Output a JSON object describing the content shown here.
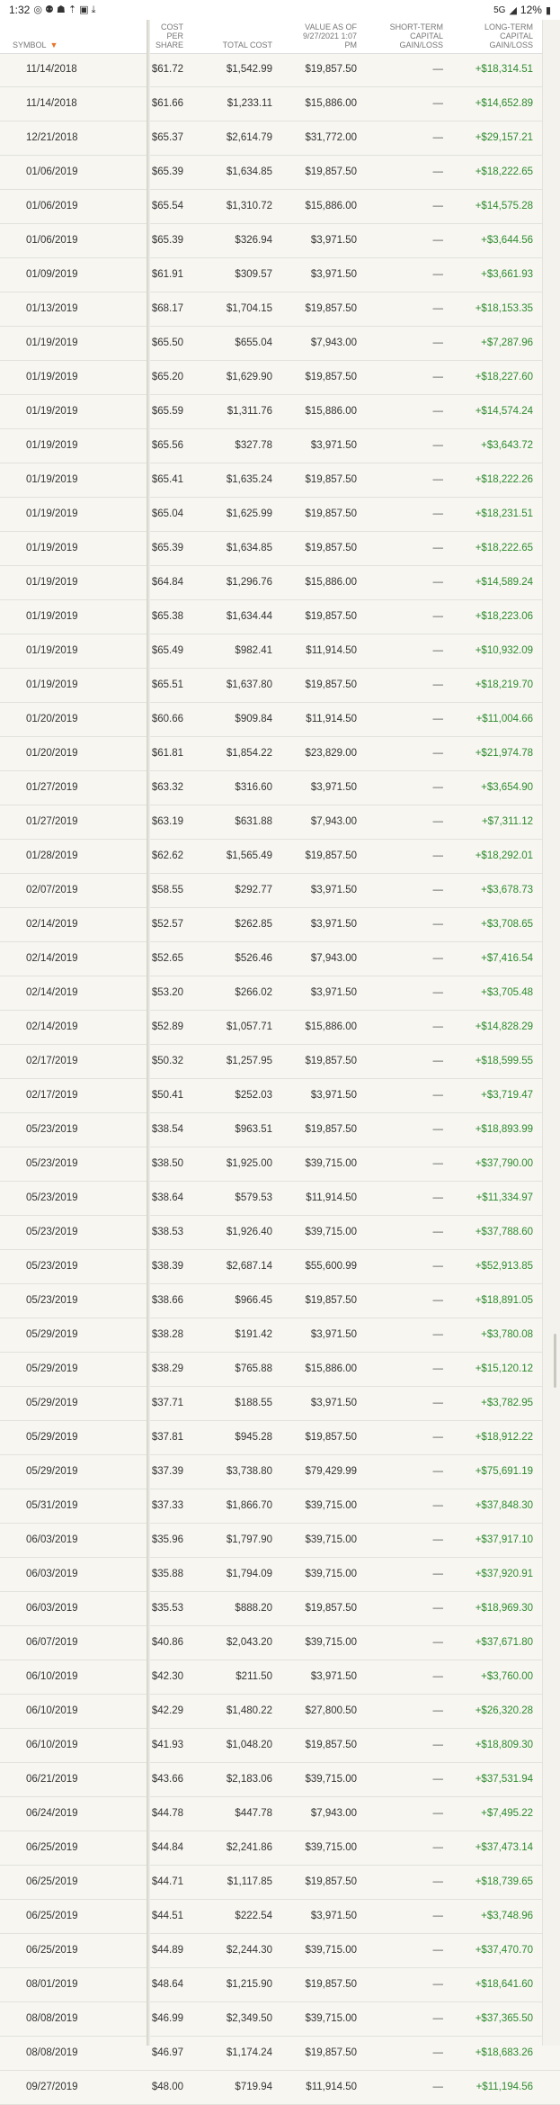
{
  "statusbar": {
    "time": "1:32",
    "network": "5G",
    "battery": "12%"
  },
  "header": {
    "symbol": "SYMBOL",
    "cost_per_share": [
      "COST",
      "PER",
      "SHARE"
    ],
    "total_cost": "TOTAL COST",
    "value_as_of": [
      "VALUE AS OF",
      "9/27/2021 1:07",
      "PM"
    ],
    "short_term": [
      "SHORT-TERM",
      "CAPITAL",
      "GAIN/LOSS"
    ],
    "long_term": [
      "LONG-TERM",
      "CAPITAL",
      "GAIN/LOSS"
    ]
  },
  "rows": [
    {
      "date": "11/14/2018",
      "cps": "$61.72",
      "tc": "$1,542.99",
      "val": "$19,857.50",
      "st": "—",
      "lt": "+$18,314.51"
    },
    {
      "date": "11/14/2018",
      "cps": "$61.66",
      "tc": "$1,233.11",
      "val": "$15,886.00",
      "st": "—",
      "lt": "+$14,652.89"
    },
    {
      "date": "12/21/2018",
      "cps": "$65.37",
      "tc": "$2,614.79",
      "val": "$31,772.00",
      "st": "—",
      "lt": "+$29,157.21"
    },
    {
      "date": "01/06/2019",
      "cps": "$65.39",
      "tc": "$1,634.85",
      "val": "$19,857.50",
      "st": "—",
      "lt": "+$18,222.65"
    },
    {
      "date": "01/06/2019",
      "cps": "$65.54",
      "tc": "$1,310.72",
      "val": "$15,886.00",
      "st": "—",
      "lt": "+$14,575.28"
    },
    {
      "date": "01/06/2019",
      "cps": "$65.39",
      "tc": "$326.94",
      "val": "$3,971.50",
      "st": "—",
      "lt": "+$3,644.56"
    },
    {
      "date": "01/09/2019",
      "cps": "$61.91",
      "tc": "$309.57",
      "val": "$3,971.50",
      "st": "—",
      "lt": "+$3,661.93"
    },
    {
      "date": "01/13/2019",
      "cps": "$68.17",
      "tc": "$1,704.15",
      "val": "$19,857.50",
      "st": "—",
      "lt": "+$18,153.35"
    },
    {
      "date": "01/19/2019",
      "cps": "$65.50",
      "tc": "$655.04",
      "val": "$7,943.00",
      "st": "—",
      "lt": "+$7,287.96"
    },
    {
      "date": "01/19/2019",
      "cps": "$65.20",
      "tc": "$1,629.90",
      "val": "$19,857.50",
      "st": "—",
      "lt": "+$18,227.60"
    },
    {
      "date": "01/19/2019",
      "cps": "$65.59",
      "tc": "$1,311.76",
      "val": "$15,886.00",
      "st": "—",
      "lt": "+$14,574.24"
    },
    {
      "date": "01/19/2019",
      "cps": "$65.56",
      "tc": "$327.78",
      "val": "$3,971.50",
      "st": "—",
      "lt": "+$3,643.72"
    },
    {
      "date": "01/19/2019",
      "cps": "$65.41",
      "tc": "$1,635.24",
      "val": "$19,857.50",
      "st": "—",
      "lt": "+$18,222.26"
    },
    {
      "date": "01/19/2019",
      "cps": "$65.04",
      "tc": "$1,625.99",
      "val": "$19,857.50",
      "st": "—",
      "lt": "+$18,231.51"
    },
    {
      "date": "01/19/2019",
      "cps": "$65.39",
      "tc": "$1,634.85",
      "val": "$19,857.50",
      "st": "—",
      "lt": "+$18,222.65"
    },
    {
      "date": "01/19/2019",
      "cps": "$64.84",
      "tc": "$1,296.76",
      "val": "$15,886.00",
      "st": "—",
      "lt": "+$14,589.24"
    },
    {
      "date": "01/19/2019",
      "cps": "$65.38",
      "tc": "$1,634.44",
      "val": "$19,857.50",
      "st": "—",
      "lt": "+$18,223.06"
    },
    {
      "date": "01/19/2019",
      "cps": "$65.49",
      "tc": "$982.41",
      "val": "$11,914.50",
      "st": "—",
      "lt": "+$10,932.09"
    },
    {
      "date": "01/19/2019",
      "cps": "$65.51",
      "tc": "$1,637.80",
      "val": "$19,857.50",
      "st": "—",
      "lt": "+$18,219.70"
    },
    {
      "date": "01/20/2019",
      "cps": "$60.66",
      "tc": "$909.84",
      "val": "$11,914.50",
      "st": "—",
      "lt": "+$11,004.66"
    },
    {
      "date": "01/20/2019",
      "cps": "$61.81",
      "tc": "$1,854.22",
      "val": "$23,829.00",
      "st": "—",
      "lt": "+$21,974.78"
    },
    {
      "date": "01/27/2019",
      "cps": "$63.32",
      "tc": "$316.60",
      "val": "$3,971.50",
      "st": "—",
      "lt": "+$3,654.90"
    },
    {
      "date": "01/27/2019",
      "cps": "$63.19",
      "tc": "$631.88",
      "val": "$7,943.00",
      "st": "—",
      "lt": "+$7,311.12"
    },
    {
      "date": "01/28/2019",
      "cps": "$62.62",
      "tc": "$1,565.49",
      "val": "$19,857.50",
      "st": "—",
      "lt": "+$18,292.01"
    },
    {
      "date": "02/07/2019",
      "cps": "$58.55",
      "tc": "$292.77",
      "val": "$3,971.50",
      "st": "—",
      "lt": "+$3,678.73"
    },
    {
      "date": "02/14/2019",
      "cps": "$52.57",
      "tc": "$262.85",
      "val": "$3,971.50",
      "st": "—",
      "lt": "+$3,708.65"
    },
    {
      "date": "02/14/2019",
      "cps": "$52.65",
      "tc": "$526.46",
      "val": "$7,943.00",
      "st": "—",
      "lt": "+$7,416.54"
    },
    {
      "date": "02/14/2019",
      "cps": "$53.20",
      "tc": "$266.02",
      "val": "$3,971.50",
      "st": "—",
      "lt": "+$3,705.48"
    },
    {
      "date": "02/14/2019",
      "cps": "$52.89",
      "tc": "$1,057.71",
      "val": "$15,886.00",
      "st": "—",
      "lt": "+$14,828.29"
    },
    {
      "date": "02/17/2019",
      "cps": "$50.32",
      "tc": "$1,257.95",
      "val": "$19,857.50",
      "st": "—",
      "lt": "+$18,599.55"
    },
    {
      "date": "02/17/2019",
      "cps": "$50.41",
      "tc": "$252.03",
      "val": "$3,971.50",
      "st": "—",
      "lt": "+$3,719.47"
    },
    {
      "date": "05/23/2019",
      "cps": "$38.54",
      "tc": "$963.51",
      "val": "$19,857.50",
      "st": "—",
      "lt": "+$18,893.99"
    },
    {
      "date": "05/23/2019",
      "cps": "$38.50",
      "tc": "$1,925.00",
      "val": "$39,715.00",
      "st": "—",
      "lt": "+$37,790.00"
    },
    {
      "date": "05/23/2019",
      "cps": "$38.64",
      "tc": "$579.53",
      "val": "$11,914.50",
      "st": "—",
      "lt": "+$11,334.97"
    },
    {
      "date": "05/23/2019",
      "cps": "$38.53",
      "tc": "$1,926.40",
      "val": "$39,715.00",
      "st": "—",
      "lt": "+$37,788.60"
    },
    {
      "date": "05/23/2019",
      "cps": "$38.39",
      "tc": "$2,687.14",
      "val": "$55,600.99",
      "st": "—",
      "lt": "+$52,913.85"
    },
    {
      "date": "05/23/2019",
      "cps": "$38.66",
      "tc": "$966.45",
      "val": "$19,857.50",
      "st": "—",
      "lt": "+$18,891.05"
    },
    {
      "date": "05/29/2019",
      "cps": "$38.28",
      "tc": "$191.42",
      "val": "$3,971.50",
      "st": "—",
      "lt": "+$3,780.08"
    },
    {
      "date": "05/29/2019",
      "cps": "$38.29",
      "tc": "$765.88",
      "val": "$15,886.00",
      "st": "—",
      "lt": "+$15,120.12"
    },
    {
      "date": "05/29/2019",
      "cps": "$37.71",
      "tc": "$188.55",
      "val": "$3,971.50",
      "st": "—",
      "lt": "+$3,782.95"
    },
    {
      "date": "05/29/2019",
      "cps": "$37.81",
      "tc": "$945.28",
      "val": "$19,857.50",
      "st": "—",
      "lt": "+$18,912.22"
    },
    {
      "date": "05/29/2019",
      "cps": "$37.39",
      "tc": "$3,738.80",
      "val": "$79,429.99",
      "st": "—",
      "lt": "+$75,691.19"
    },
    {
      "date": "05/31/2019",
      "cps": "$37.33",
      "tc": "$1,866.70",
      "val": "$39,715.00",
      "st": "—",
      "lt": "+$37,848.30"
    },
    {
      "date": "06/03/2019",
      "cps": "$35.96",
      "tc": "$1,797.90",
      "val": "$39,715.00",
      "st": "—",
      "lt": "+$37,917.10"
    },
    {
      "date": "06/03/2019",
      "cps": "$35.88",
      "tc": "$1,794.09",
      "val": "$39,715.00",
      "st": "—",
      "lt": "+$37,920.91"
    },
    {
      "date": "06/03/2019",
      "cps": "$35.53",
      "tc": "$888.20",
      "val": "$19,857.50",
      "st": "—",
      "lt": "+$18,969.30"
    },
    {
      "date": "06/07/2019",
      "cps": "$40.86",
      "tc": "$2,043.20",
      "val": "$39,715.00",
      "st": "—",
      "lt": "+$37,671.80"
    },
    {
      "date": "06/10/2019",
      "cps": "$42.30",
      "tc": "$211.50",
      "val": "$3,971.50",
      "st": "—",
      "lt": "+$3,760.00"
    },
    {
      "date": "06/10/2019",
      "cps": "$42.29",
      "tc": "$1,480.22",
      "val": "$27,800.50",
      "st": "—",
      "lt": "+$26,320.28"
    },
    {
      "date": "06/10/2019",
      "cps": "$41.93",
      "tc": "$1,048.20",
      "val": "$19,857.50",
      "st": "—",
      "lt": "+$18,809.30"
    },
    {
      "date": "06/21/2019",
      "cps": "$43.66",
      "tc": "$2,183.06",
      "val": "$39,715.00",
      "st": "—",
      "lt": "+$37,531.94"
    },
    {
      "date": "06/24/2019",
      "cps": "$44.78",
      "tc": "$447.78",
      "val": "$7,943.00",
      "st": "—",
      "lt": "+$7,495.22"
    },
    {
      "date": "06/25/2019",
      "cps": "$44.84",
      "tc": "$2,241.86",
      "val": "$39,715.00",
      "st": "—",
      "lt": "+$37,473.14"
    },
    {
      "date": "06/25/2019",
      "cps": "$44.71",
      "tc": "$1,117.85",
      "val": "$19,857.50",
      "st": "—",
      "lt": "+$18,739.65"
    },
    {
      "date": "06/25/2019",
      "cps": "$44.51",
      "tc": "$222.54",
      "val": "$3,971.50",
      "st": "—",
      "lt": "+$3,748.96"
    },
    {
      "date": "06/25/2019",
      "cps": "$44.89",
      "tc": "$2,244.30",
      "val": "$39,715.00",
      "st": "—",
      "lt": "+$37,470.70"
    },
    {
      "date": "08/01/2019",
      "cps": "$48.64",
      "tc": "$1,215.90",
      "val": "$19,857.50",
      "st": "—",
      "lt": "+$18,641.60"
    },
    {
      "date": "08/08/2019",
      "cps": "$46.99",
      "tc": "$2,349.50",
      "val": "$39,715.00",
      "st": "—",
      "lt": "+$37,365.50"
    },
    {
      "date": "08/08/2019",
      "cps": "$46.97",
      "tc": "$1,174.24",
      "val": "$19,857.50",
      "st": "—",
      "lt": "+$18,683.26"
    },
    {
      "date": "09/27/2019",
      "cps": "$48.00",
      "tc": "$719.94",
      "val": "$11,914.50",
      "st": "—",
      "lt": "+$11,194.56"
    }
  ]
}
